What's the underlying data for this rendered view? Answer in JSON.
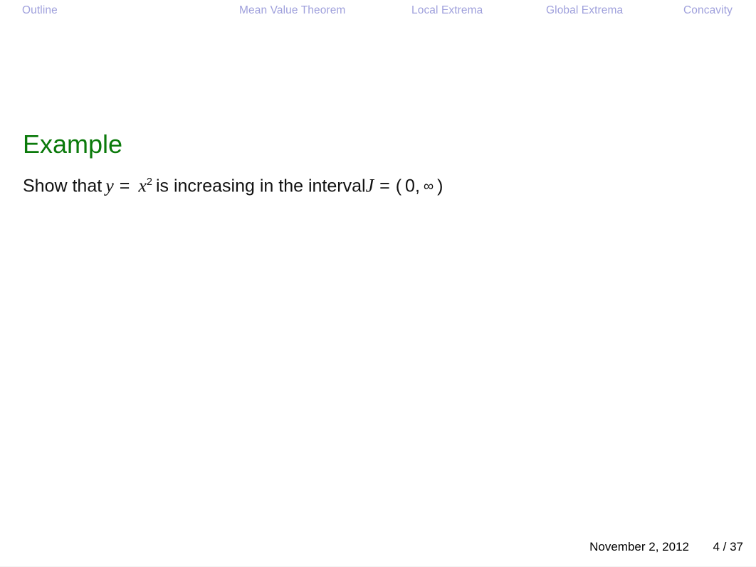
{
  "slide": {
    "background_color": "#ffffff",
    "nav_color": "#9fa0dc",
    "title_color": "#0b7a0b",
    "text_color": "#111111"
  },
  "navbar": {
    "items": [
      {
        "label": "Outline"
      },
      {
        "label": "Mean Value Theorem"
      },
      {
        "label": "Local Extrema"
      },
      {
        "label": "Global Extrema"
      },
      {
        "label": "Concavity"
      }
    ]
  },
  "block": {
    "title": "Example",
    "text_full": "Show that y = x2 is increasing in the interval J = ( 0, ∞ )",
    "parts": {
      "lead": "Show that",
      "var_y": "y",
      "equals1": "=",
      "var_x": "x",
      "exponent": "2",
      "middle": "is increasing in the interval",
      "var_J": "J",
      "equals2": "=",
      "paren_open": "(",
      "lower_bound": "0,",
      "infinity": "∞",
      "paren_close": ")"
    }
  },
  "footer": {
    "date": "November 2, 2012",
    "page": "4 / 37"
  }
}
